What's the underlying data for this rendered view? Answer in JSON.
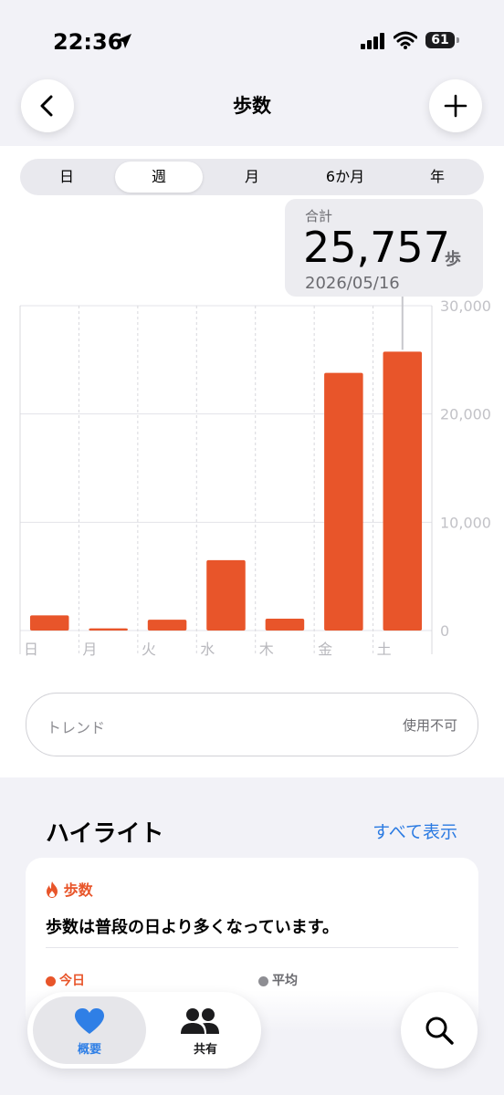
{
  "status_bar": {
    "time": "22:36",
    "battery": "61"
  },
  "nav": {
    "title": "歩数"
  },
  "segments": [
    "日",
    "週",
    "月",
    "6か月",
    "年"
  ],
  "selected_segment": 1,
  "callout": {
    "label": "合計",
    "value": "25,757",
    "unit": "歩",
    "date": "2026/05/16"
  },
  "chart_data": {
    "type": "bar",
    "categories": [
      "日",
      "月",
      "火",
      "水",
      "木",
      "金",
      "土"
    ],
    "values": [
      1400,
      200,
      1000,
      6500,
      1100,
      23800,
      25757
    ],
    "ylim": [
      0,
      30000
    ],
    "yticks": [
      "30,000",
      "20,000",
      "10,000",
      "0"
    ],
    "highlighted_index": 6,
    "bar_color": "#e8552a",
    "grid": true
  },
  "trend": {
    "label": "トレンド",
    "status": "使用不可"
  },
  "highlights": {
    "title": "ハイライト",
    "show_all": "すべて表示",
    "card": {
      "title": "歩数",
      "message": "歩数は普段の日より多くなっています。",
      "today_label": "今日",
      "avg_label": "平均"
    }
  },
  "tabs": [
    {
      "label": "概要",
      "icon": "heart-icon"
    },
    {
      "label": "共有",
      "icon": "people-icon"
    }
  ],
  "colors": {
    "accent": "#e8552a",
    "link": "#2a7ae2",
    "tab_active": "#2f7fe6"
  }
}
